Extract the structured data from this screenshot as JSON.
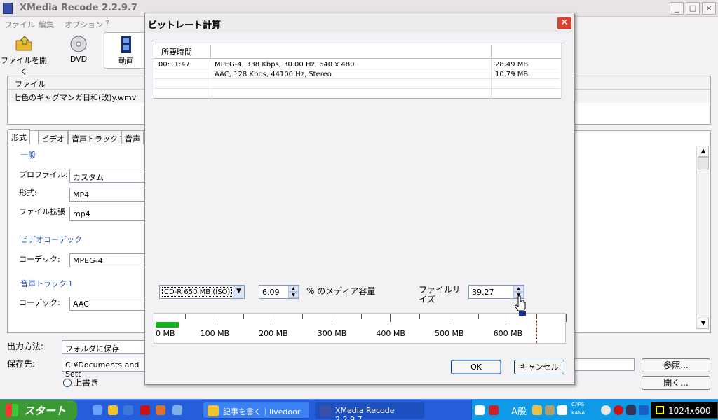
{
  "main_window": {
    "title": "XMedia Recode 2.2.9.7",
    "menu": [
      "ファイル",
      "編集",
      "オプション",
      "?"
    ],
    "toolbar": [
      {
        "label": "ファイルを開く",
        "icon": "open-folder-icon"
      },
      {
        "label": "DVD",
        "icon": "dvd-disc-icon"
      },
      {
        "label": "動画",
        "icon": "film-icon"
      }
    ],
    "file_list": {
      "header": "ファイル",
      "rows": [
        "七色のギャグマンガ日和(改)y.wmv"
      ]
    },
    "tabs": [
      "形式",
      "ビデオ",
      "音声トラック１",
      "音声"
    ],
    "groups": {
      "general": {
        "title": "一般",
        "fields": [
          {
            "label": "プロファイル:",
            "value": "カスタム"
          },
          {
            "label": "形式:",
            "value": "MP4"
          },
          {
            "label": "ファイル拡張",
            "value": "mp4"
          }
        ]
      },
      "video_codec": {
        "title": "ビデオコーデック",
        "fields": [
          {
            "label": "コーデック:",
            "value": "MPEG-4"
          }
        ]
      },
      "audio_track": {
        "title": "音声トラック１",
        "fields": [
          {
            "label": "コーデック:",
            "value": "AAC"
          }
        ]
      }
    },
    "output_method": {
      "label": "出力方法:",
      "value": "フォルダに保存"
    },
    "save_to": {
      "label": "保存先:",
      "value": "C:¥Documents and Sett"
    },
    "overwrite_label": "上書き",
    "browse_button": "参照...",
    "open_button": "開く..."
  },
  "dialog": {
    "title": "ビットレート計算",
    "table": {
      "headers": [
        "所要時間",
        "",
        ""
      ],
      "rows": [
        {
          "duration": "00:11:47",
          "stream": "MPEG-4, 338 Kbps, 30.00 Hz, 640 x 480",
          "size": "28.49 MB"
        },
        {
          "duration": "",
          "stream": "AAC, 128 Kbps, 44100 Hz, Stereo",
          "size": "10.79 MB"
        }
      ]
    },
    "media_select": "CD-R 650 MB (ISO)",
    "percent_value": "6.09",
    "percent_label": "% のメディア容量",
    "filesize_label": "ファイルサイズ",
    "filesize_value": "39.27",
    "scale": {
      "labels": [
        "0 MB",
        "100 MB",
        "200 MB",
        "300 MB",
        "400 MB",
        "500 MB",
        "600 MB"
      ],
      "max_mb": 700,
      "capacity_mb": 650,
      "used_mb": 39.27,
      "used_color": "#16b01d"
    },
    "ok_button": "OK",
    "cancel_button": "キャンセル"
  },
  "taskbar": {
    "start_label": "スタート",
    "tasks": [
      {
        "label": "記事を書く｜livedoor ...",
        "active": false
      },
      {
        "label": "XMedia Recode 2.2.9.7",
        "active": true
      }
    ],
    "tray_text": "A般",
    "caps": "CAPS",
    "kana": "KANA",
    "resolution": "1024x600"
  }
}
